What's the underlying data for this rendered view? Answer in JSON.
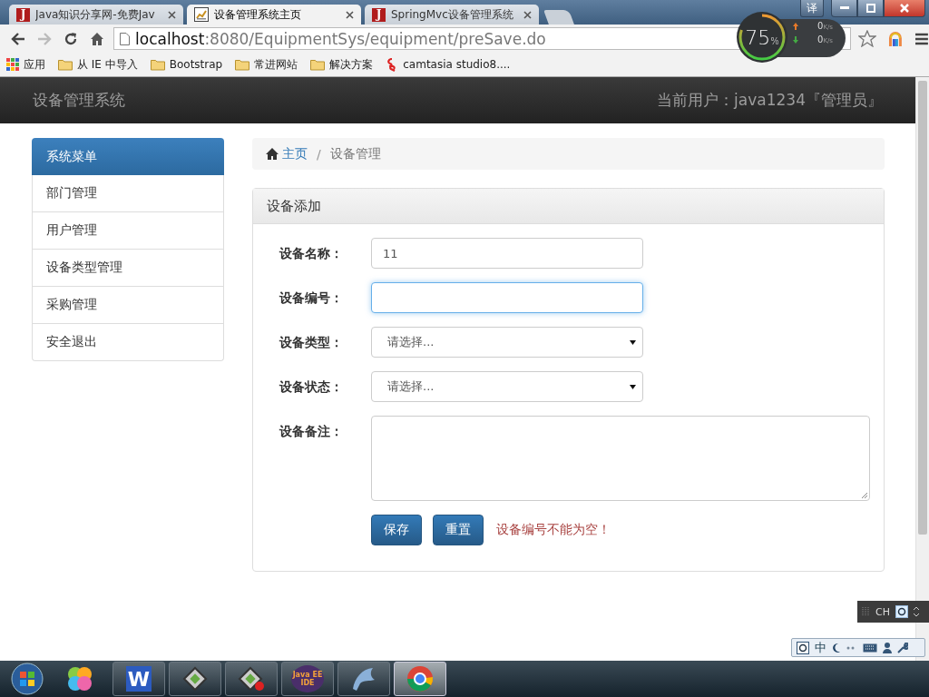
{
  "browser": {
    "tabs": [
      {
        "title": "Java知识分享网-免费Jav",
        "selected": false,
        "favicon": {
          "kind": "letter",
          "text": "J"
        }
      },
      {
        "title": "设备管理系统主页",
        "selected": true,
        "favicon": {
          "kind": "chart"
        }
      },
      {
        "title": "SpringMvc设备管理系统",
        "selected": false,
        "favicon": {
          "kind": "letter",
          "text": "J"
        }
      }
    ],
    "translate_button": "译",
    "address": {
      "host": "localhost",
      "path": ":8080/EquipmentSys/equipment/preSave.do"
    },
    "bookmarks": [
      {
        "label": "应用",
        "kind": "apps"
      },
      {
        "label": "从 IE 中导入",
        "kind": "folder"
      },
      {
        "label": "Bootstrap",
        "kind": "folder"
      },
      {
        "label": "常进网站",
        "kind": "folder"
      },
      {
        "label": "解决方案",
        "kind": "folder"
      },
      {
        "label": "camtasia studio8....",
        "kind": "site"
      }
    ]
  },
  "speed_meter": {
    "percent": "75",
    "percent_sign": "%",
    "upload": {
      "value": "0",
      "unit": "K/s"
    },
    "download": {
      "value": "0",
      "unit": "K/s"
    }
  },
  "app": {
    "brand": "设备管理系统",
    "current_user": "当前用户：java1234『管理员』"
  },
  "sidebar": {
    "title": "系统菜单",
    "items": [
      "部门管理",
      "用户管理",
      "设备类型管理",
      "采购管理",
      "安全退出"
    ]
  },
  "breadcrumb": [
    {
      "label": "主页",
      "kind": "home"
    },
    {
      "label": "设备管理",
      "kind": "current",
      "separator": "/"
    }
  ],
  "panel": {
    "title": "设备添加",
    "fields": [
      {
        "label": "设备名称：",
        "kind": "text",
        "value": "11",
        "focused": false
      },
      {
        "label": "设备编号：",
        "kind": "text",
        "focused": true
      },
      {
        "label": "设备类型：",
        "kind": "select",
        "value": "请选择...",
        "focused": false
      },
      {
        "label": "设备状态：",
        "kind": "select",
        "value": "请选择...",
        "focused": false
      },
      {
        "label": "设备备注：",
        "kind": "textarea",
        "focused": false
      }
    ],
    "buttons": [
      "保存",
      "重置"
    ],
    "error": "设备编号不能为空！"
  },
  "ime_bar": {
    "label": "CH"
  },
  "language_bar": {
    "label": "中"
  },
  "taskbar": {
    "items": [
      {
        "kind": "start",
        "selected": false
      },
      {
        "kind": "pinwheel",
        "selected": false
      },
      {
        "kind": "wps",
        "label": "W",
        "selected": false
      },
      {
        "kind": "screen",
        "selected": false
      },
      {
        "kind": "screen-record",
        "selected": false
      },
      {
        "kind": "ide",
        "label": "Java EE IDE",
        "selected": false
      },
      {
        "kind": "dolphin",
        "selected": false
      },
      {
        "kind": "chrome",
        "selected": true
      }
    ]
  }
}
